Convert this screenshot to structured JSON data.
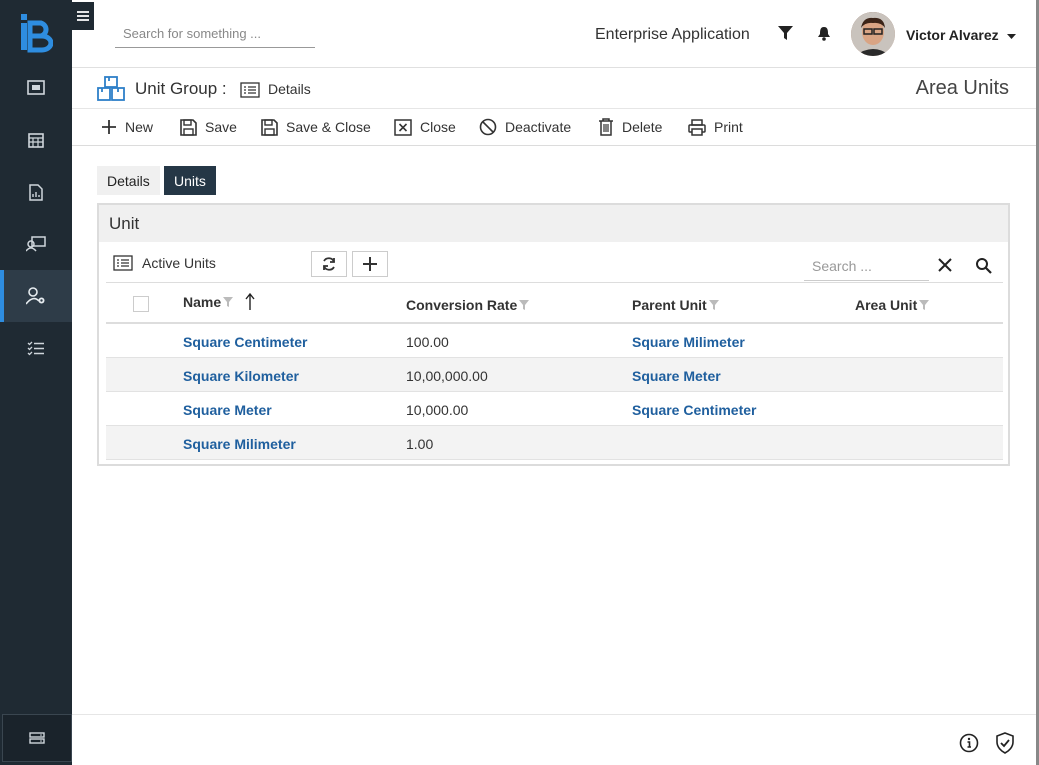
{
  "search": {
    "placeholder": "Search for something ..."
  },
  "topbar": {
    "app_name": "Enterprise Application",
    "user_name": "Victor Alvarez"
  },
  "header": {
    "entity": "Unit Group :",
    "view": "Details",
    "record_title": "Area Units"
  },
  "toolbar": {
    "new": "New",
    "save": "Save",
    "save_close": "Save & Close",
    "close": "Close",
    "deactivate": "Deactivate",
    "delete": "Delete",
    "print": "Print"
  },
  "tabs": {
    "details": "Details",
    "units": "Units"
  },
  "panel": {
    "title": "Unit",
    "view_name": "Active Units",
    "search_placeholder": "Search ...",
    "columns": {
      "name": "Name",
      "rate": "Conversion Rate",
      "parent": "Parent Unit",
      "area": "Area Unit"
    },
    "rows": [
      {
        "name": "Square Centimeter",
        "rate": "100.00",
        "parent": "Square Milimeter",
        "area": ""
      },
      {
        "name": "Square Kilometer",
        "rate": "10,00,000.00",
        "parent": "Square Meter",
        "area": ""
      },
      {
        "name": "Square Meter",
        "rate": "10,000.00",
        "parent": "Square Centimeter",
        "area": ""
      },
      {
        "name": "Square Milimeter",
        "rate": "1.00",
        "parent": "",
        "area": ""
      }
    ]
  },
  "colors": {
    "sidebar": "#1f2a33",
    "accent": "#2e8de0",
    "link": "#1f5f9e",
    "active_tab": "#253746"
  }
}
